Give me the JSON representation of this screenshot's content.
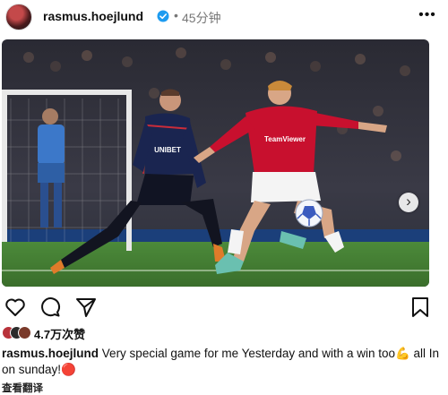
{
  "post": {
    "username": "rasmus.hoejlund",
    "separator": "•",
    "time": "45分钟",
    "more_icon": "•••",
    "next_icon": "›",
    "likes": "4.7万次赞",
    "caption_user": "rasmus.hoejlund",
    "caption_text": "Very special game for me Yesterday and with a win too💪 all In on sunday!🔴",
    "translate": "查看翻译"
  },
  "photo": {
    "sponsor_left": "UNIBET",
    "sponsor_right": "TeamViewer"
  },
  "icons": {
    "verified": "verified-badge-icon",
    "like": "heart-icon",
    "comment": "comment-icon",
    "share": "paper-plane-icon",
    "save": "bookmark-icon"
  },
  "colors": {
    "verified_blue": "#1d9bf0",
    "united_red": "#c8102e",
    "copenhagen_navy": "#1a2550",
    "pitch_green": "#3f7f2f"
  }
}
